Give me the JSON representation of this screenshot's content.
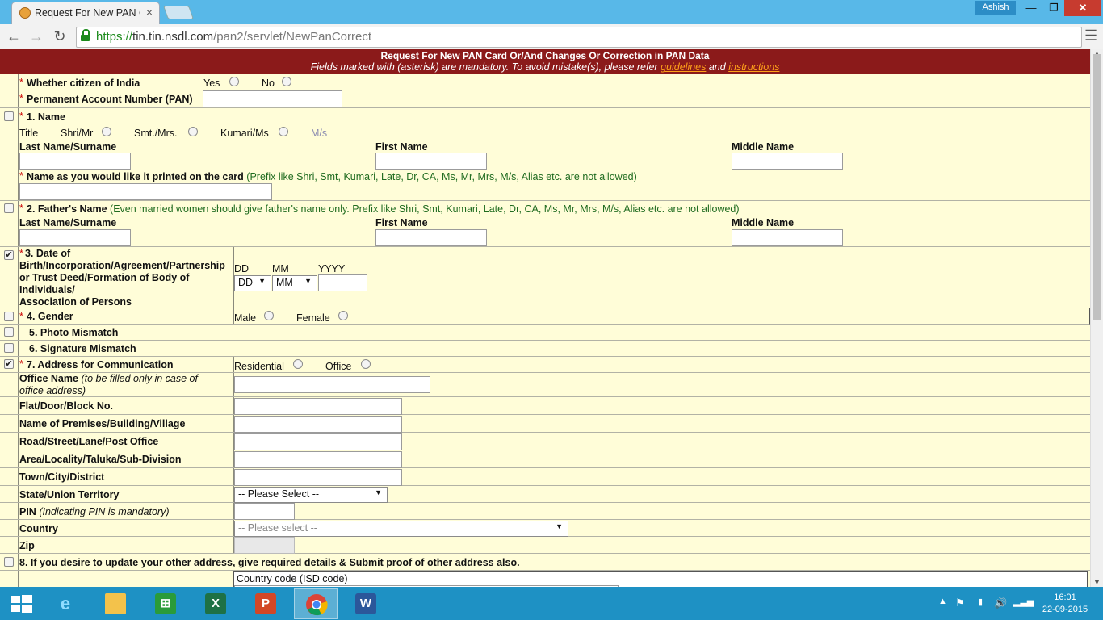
{
  "browser": {
    "tab_title": "Request For New PAN Card Or",
    "user": "Ashish",
    "url_scheme": "https://",
    "url_host": "tin.tin.nsdl.com",
    "url_path": "/pan2/servlet/NewPanCorrect"
  },
  "banner": {
    "title": "Request For New PAN Card Or/And Changes Or Correction in PAN Data",
    "sub_prefix": "Fields marked with   (asterisk) are mandatory.   To avoid mistake(s), please refer ",
    "guidelines": "guidelines",
    "and": " and ",
    "instructions": "instructions"
  },
  "form": {
    "asterisk": "*",
    "citizen": {
      "label": "Whether citizen of India",
      "yes": "Yes",
      "no": "No"
    },
    "pan": {
      "label": "Permanent Account Number (PAN)"
    },
    "name": {
      "label": "1. Name",
      "title": "Title",
      "shri": "Shri/Mr",
      "smt": "Smt./Mrs.",
      "kumari": "Kumari/Ms",
      "ms": "M/s",
      "last": "Last Name/Surname",
      "first": "First Name",
      "middle": "Middle Name"
    },
    "printed": {
      "label": "Name as you would like it printed on the card",
      "note": "(Prefix like Shri, Smt, Kumari, Late, Dr, CA, Ms, Mr, Mrs, M/s, Alias etc. are not allowed)"
    },
    "father": {
      "label": "2. Father's Name",
      "note": "(Even married women should give father's name only. Prefix like Shri, Smt, Kumari, Late, Dr, CA, Ms, Mr, Mrs, M/s, Alias etc. are not allowed)",
      "last": "Last Name/Surname",
      "first": "First Name",
      "middle": "Middle Name"
    },
    "dob": {
      "line1": "3. Date of",
      "line2": "Birth/Incorporation/Agreement/Partnership",
      "line3": "or Trust Deed/Formation of Body of",
      "line4": "Individuals/",
      "line5": "Association of Persons",
      "dd_label": "DD",
      "mm_label": "MM",
      "yyyy_label": "YYYY",
      "dd_value": "DD",
      "mm_value": "MM"
    },
    "gender": {
      "label": "4. Gender",
      "male": "Male",
      "female": "Female"
    },
    "photo": {
      "label": "5. Photo Mismatch"
    },
    "signature": {
      "label": "6. Signature Mismatch"
    },
    "address": {
      "label": "7. Address for Communication",
      "residential": "Residential",
      "office": "Office",
      "office_name": "Office Name",
      "office_note1": "(to be filled only in case of",
      "office_note2": "office address)",
      "flat": "Flat/Door/Block No.",
      "premises": "Name of Premises/Building/Village",
      "road": "Road/Street/Lane/Post Office",
      "area": "Area/Locality/Taluka/Sub-Division",
      "town": "Town/City/District",
      "state": "State/Union Territory",
      "state_value": "-- Please Select --",
      "pin": "PIN",
      "pin_note": "(Indicating PIN is mandatory)",
      "country": "Country",
      "country_value": "-- Please select --",
      "zip": "Zip"
    },
    "other": {
      "label_prefix": "8. If you desire to update your other address, give required details & ",
      "label_link": "Submit proof of other address also",
      "label_suffix": ".",
      "isd": "Country code (ISD code)"
    }
  },
  "taskbar": {
    "time": "16:01",
    "date": "22-09-2015"
  }
}
